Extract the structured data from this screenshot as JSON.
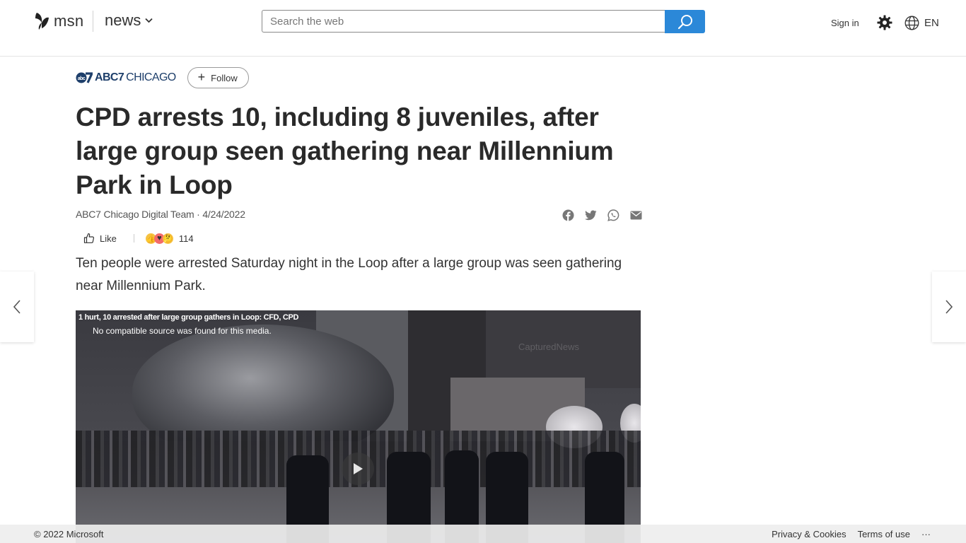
{
  "header": {
    "brand": "msn",
    "section": "news",
    "search_placeholder": "Search the web",
    "sign_in": "Sign in",
    "language": "EN"
  },
  "article": {
    "source_name_bold": "ABC7",
    "source_name_light": "CHICAGO",
    "follow_label": "Follow",
    "title": "CPD arrests 10, including 8 juveniles, after large group seen gathering near Millennium Park in Loop",
    "byline": "ABC7 Chicago Digital Team · 4/24/2022",
    "like_label": "Like",
    "reaction_count": "114",
    "lead": "Ten people were arrested Saturday night in the Loop after a large group was seen gathering near Millennium Park."
  },
  "video": {
    "caption": "1 hurt, 10 arrested after large group gathers in Loop: CFD, CPD",
    "error": "No compatible source was found for this media.",
    "watermark": "CapturedNews"
  },
  "footer": {
    "copyright": "© 2022 Microsoft",
    "links": [
      "Privacy & Cookies",
      "Terms of use"
    ],
    "more": "···"
  }
}
